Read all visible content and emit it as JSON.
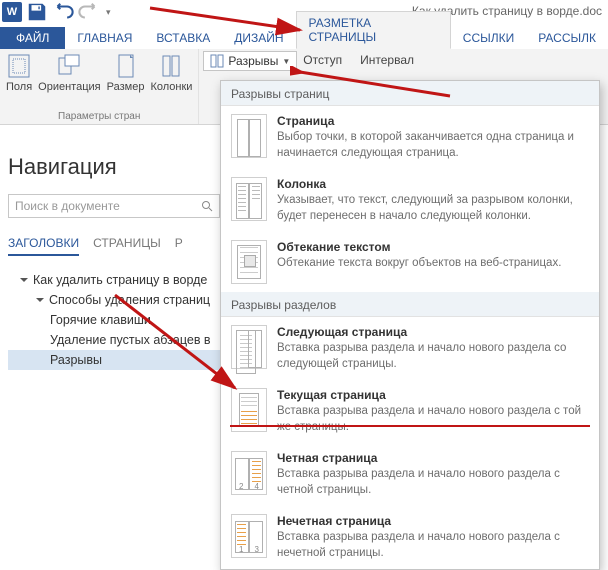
{
  "app": {
    "word_glyph": "W",
    "doc_title": "Как удалить страницу в ворде.doc"
  },
  "qat": {
    "save": "save-icon",
    "undo": "undo-icon",
    "redo": "redo-icon"
  },
  "tabs": {
    "file": "ФАЙЛ",
    "home": "ГЛАВНАЯ",
    "insert": "ВСТАВКА",
    "design": "ДИЗАЙН",
    "layout": "РАЗМЕТКА СТРАНИЦЫ",
    "references": "ССЫЛКИ",
    "mailings": "РАССЫЛК"
  },
  "ribbon": {
    "margins": "Поля",
    "orientation": "Ориентация",
    "size": "Размер",
    "columns": "Колонки",
    "group_page_setup": "Параметры стран",
    "breaks_btn": "Разрывы",
    "indent": "Отступ",
    "spacing": "Интервал"
  },
  "nav": {
    "title": "Навигация",
    "search_placeholder": "Поиск в документе",
    "tab_headings": "ЗАГОЛОВКИ",
    "tab_pages": "СТРАНИЦЫ",
    "tab_results": "Р",
    "tree": {
      "t1": "Как удалить страницу в ворде",
      "t2": "Способы удаления страниц",
      "t3": "Горячие клавиши",
      "t4": "Удаление пустых абзацев в",
      "t5": "Разрывы"
    }
  },
  "gallery": {
    "section_page": "Разрывы страниц",
    "section_section": "Разрывы разделов",
    "items": {
      "page": {
        "title": "Страница",
        "desc": "Выбор точки, в которой заканчивается одна страница и начинается следующая страница."
      },
      "column": {
        "title": "Колонка",
        "desc": "Указывает, что текст, следующий за разрывом колонки, будет перенесен в начало следующей колонки."
      },
      "wrap": {
        "title": "Обтекание текстом",
        "desc": "Обтекание текста вокруг объектов на веб-страницах."
      },
      "next": {
        "title": "Следующая страница",
        "desc": "Вставка разрыва раздела и начало нового раздела со следующей страницы."
      },
      "cont": {
        "title": "Текущая страница",
        "desc": "Вставка разрыва раздела и начало нового раздела с той же страницы."
      },
      "even": {
        "title": "Четная страница",
        "desc": "Вставка разрыва раздела и начало нового раздела с четной страницы."
      },
      "odd": {
        "title": "Нечетная страница",
        "desc": "Вставка разрыва раздела и начало нового раздела с нечетной страницы."
      }
    }
  },
  "icon_numbers": {
    "two": "2",
    "four": "4",
    "one": "1",
    "three": "3"
  }
}
